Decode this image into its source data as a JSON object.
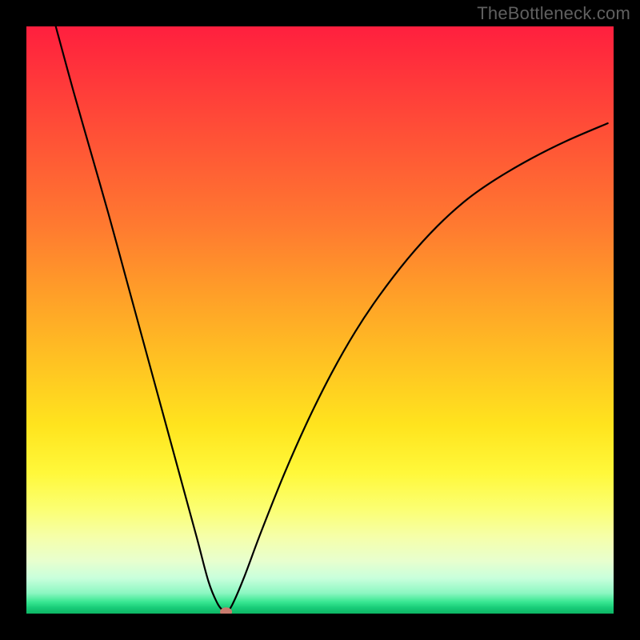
{
  "watermark": "TheBottleneck.com",
  "colors": {
    "curve": "#000000",
    "marker": "#c97b6e",
    "gradient_top": "#ff1f3e",
    "gradient_bottom": "#0db564"
  },
  "chart_data": {
    "type": "line",
    "title": "",
    "xlabel": "",
    "ylabel": "",
    "xlim": [
      0,
      100
    ],
    "ylim": [
      0,
      100
    ],
    "x": [
      5,
      8,
      11,
      14,
      17,
      20,
      23,
      26,
      29,
      31,
      32.5,
      33.5,
      34,
      35,
      37,
      40,
      44,
      48,
      52,
      56,
      60,
      65,
      70,
      75,
      80,
      86,
      92,
      99
    ],
    "values": [
      100,
      89,
      78.5,
      68,
      57,
      46,
      35,
      24,
      13,
      5.5,
      1.8,
      0.5,
      0.3,
      1.4,
      6,
      14,
      24,
      33,
      41,
      48,
      54,
      60.5,
      66,
      70.5,
      74,
      77.5,
      80.5,
      83.5
    ],
    "minimum_point": {
      "x": 34,
      "y": 0.3
    },
    "annotations": []
  }
}
